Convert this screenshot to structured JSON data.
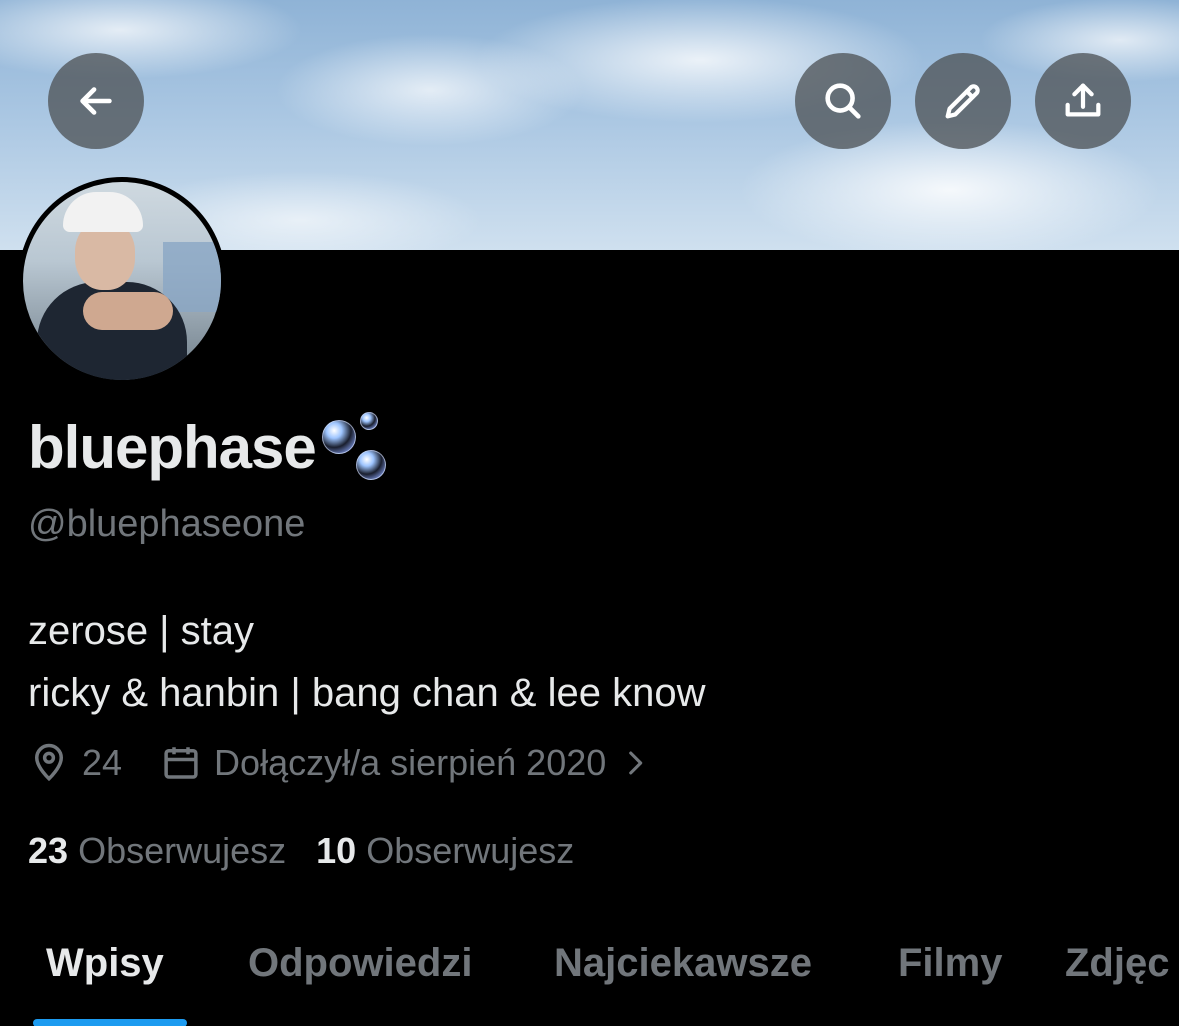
{
  "profile": {
    "display_name": "bluephase",
    "handle": "@bluephaseone",
    "bio_line1": "zerose | stay",
    "bio_line2": "ricky & hanbin | bang chan & lee know",
    "location": "24",
    "joined": "Dołączył/a sierpień 2020"
  },
  "stats": {
    "following_count": "23",
    "following_label": "Obserwujesz",
    "followers_count": "10",
    "followers_label": "Obserwujesz"
  },
  "tabs": [
    {
      "label": "Wpisy",
      "active": true
    },
    {
      "label": "Odpowiedzi",
      "active": false
    },
    {
      "label": "Najciekawsze",
      "active": false
    },
    {
      "label": "Filmy",
      "active": false
    },
    {
      "label": "Zdjęc",
      "active": false
    }
  ],
  "icons": {
    "back": "arrow-left-icon",
    "search": "search-icon",
    "edit": "pencil-icon",
    "share": "share-icon",
    "location": "location-pin-icon",
    "calendar": "calendar-icon",
    "chevron": "chevron-right-icon"
  },
  "colors": {
    "background": "#000000",
    "text_primary": "#e7e9ea",
    "text_secondary": "#71767b",
    "accent": "#1d9bf0"
  }
}
